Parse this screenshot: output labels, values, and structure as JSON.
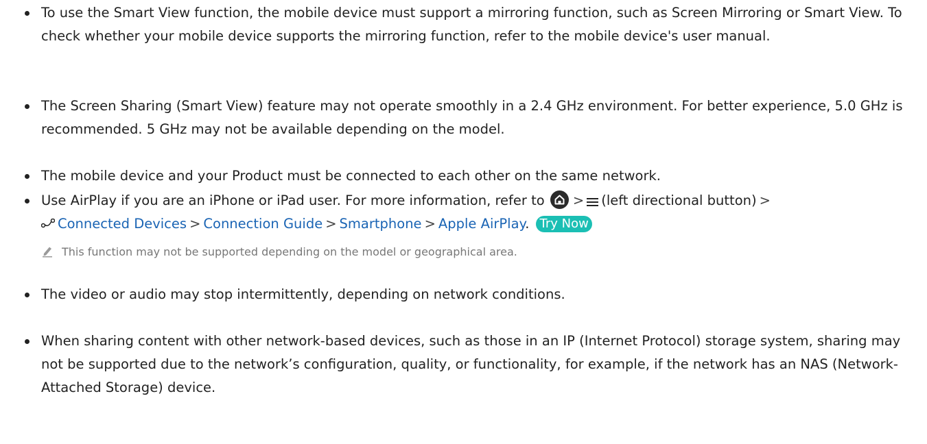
{
  "bullets": [
    {
      "id": "mirroring",
      "text": "To use the Smart View function, the mobile device must support a mirroring function, such as Screen Mirroring or Smart View. To check whether your mobile device supports the mirroring function, refer to the mobile device's user manual."
    },
    {
      "id": "frequency",
      "text": "The Screen Sharing (Smart View) feature may not operate smoothly in a 2.4 GHz environment. For better experience, 5.0 GHz is recommended. 5 GHz may not be available depending on the model."
    },
    {
      "id": "network",
      "text": "The mobile device and your Product must be connected to each other on the same network."
    },
    {
      "id": "airplay",
      "intro": "Use AirPlay if you are an iPhone or iPad user. For more information, refer to",
      "separator": ">",
      "menu_text": "(left directional button)",
      "path": [
        "Connected Devices",
        "Connection Guide",
        "Smartphone",
        "Apple AirPlay"
      ],
      "end_punct": ".",
      "try_now": "Try Now"
    },
    {
      "id": "intermittent",
      "text": "The video or audio may stop intermittently, depending on network conditions."
    },
    {
      "id": "sharing",
      "text": "When sharing content with other network-based devices, such as those in an IP (Internet Protocol) storage system, sharing may not be supported due to the network’s configuration, quality, or functionality, for example, if the network has an NAS (Network-Attached Storage) device."
    }
  ],
  "note": {
    "text": "This function may not be supported depending on the model or geographical area."
  },
  "colors": {
    "link": "#1a64b4",
    "try_now": "#1bbfb4",
    "note": "#777777"
  },
  "icons": [
    "home-icon",
    "menu-icon",
    "connected-devices-icon",
    "pencil-icon"
  ]
}
